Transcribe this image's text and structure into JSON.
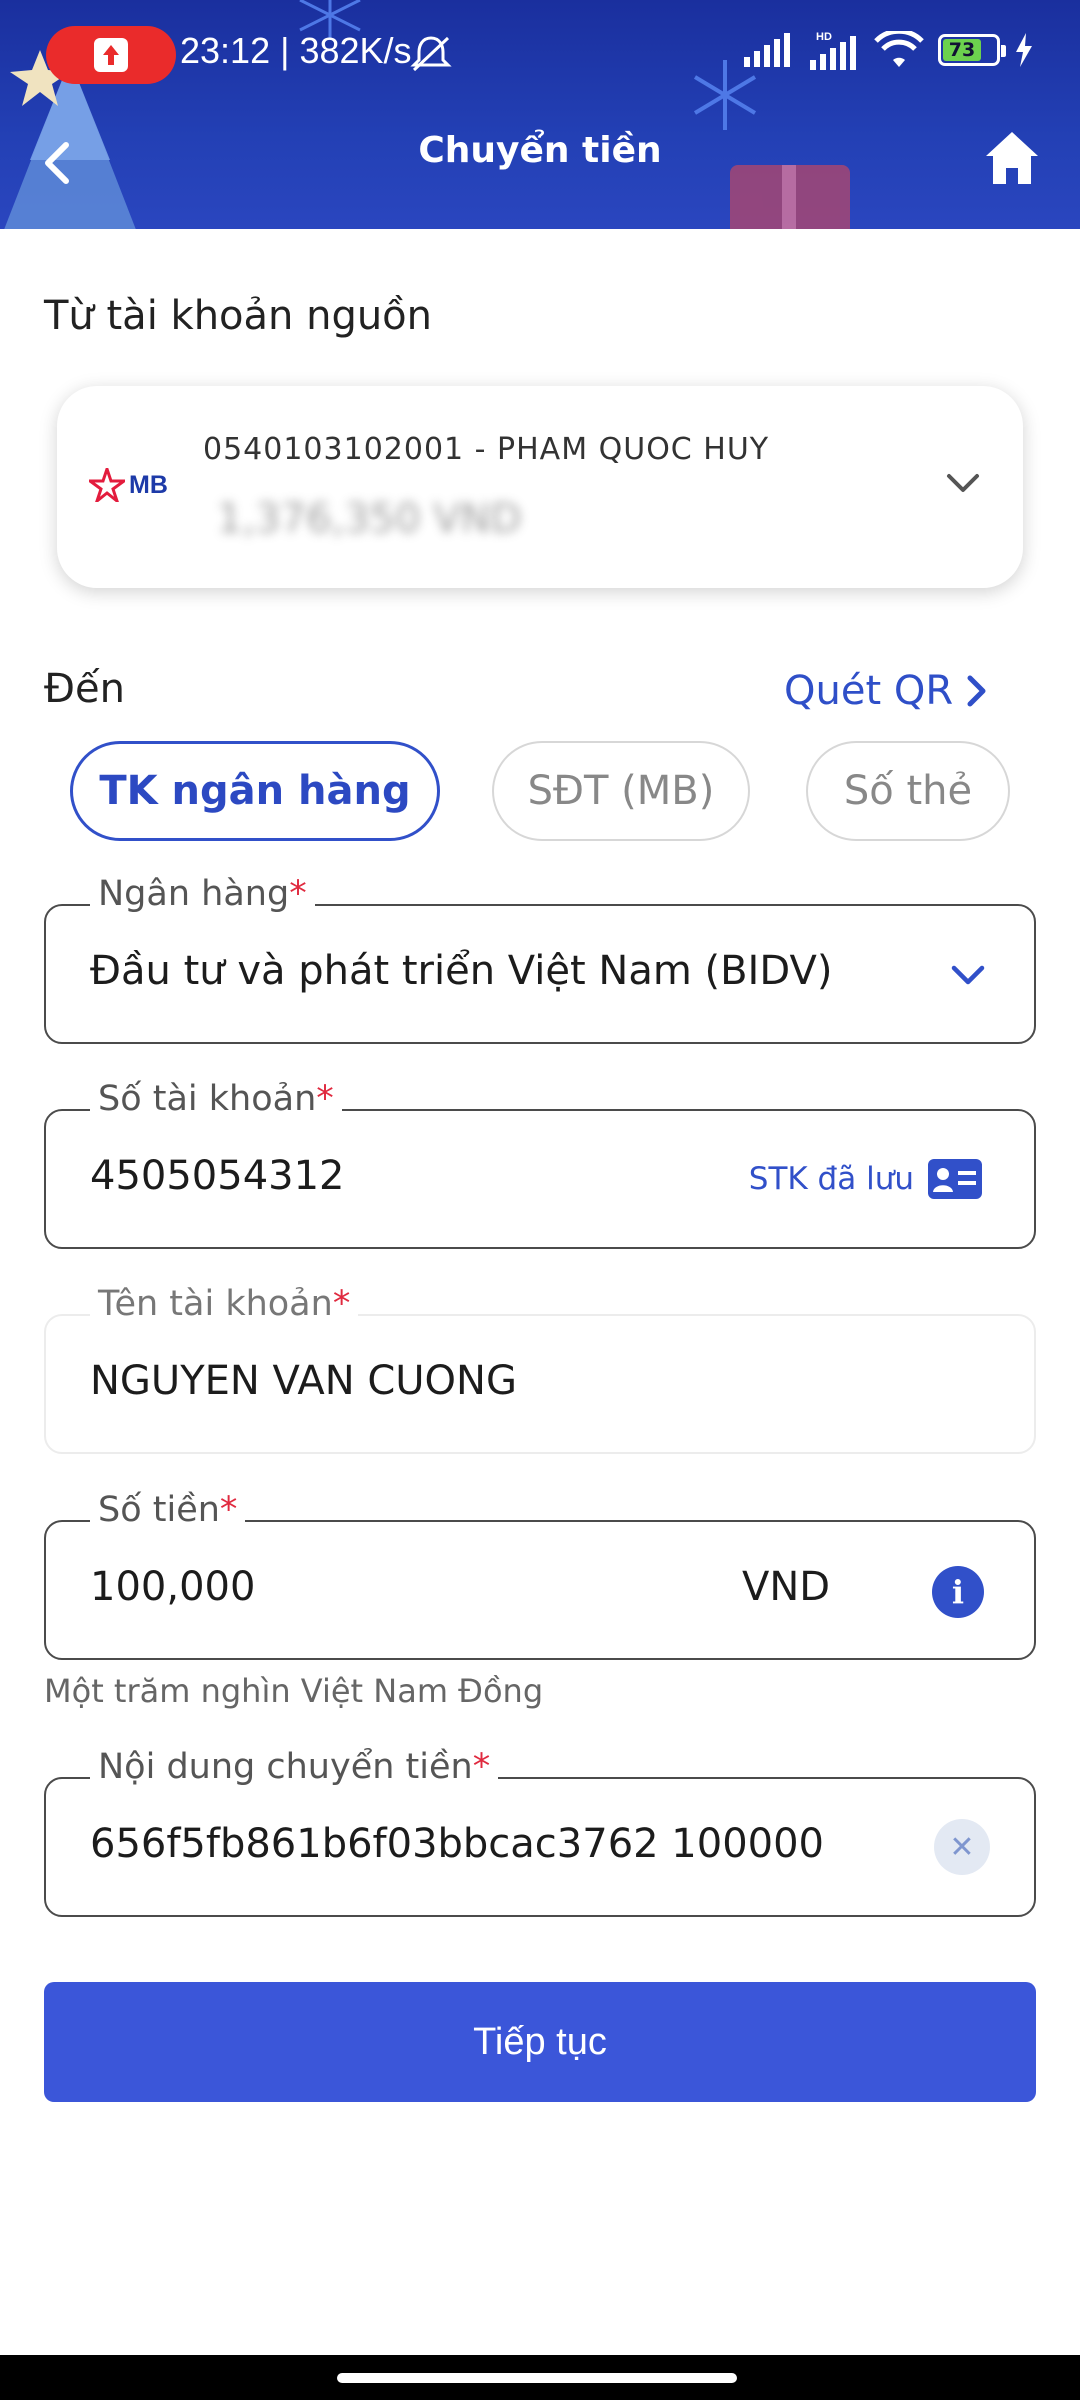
{
  "status_bar": {
    "time_speed": "23:12 | 382K/s",
    "battery": "73",
    "icons": [
      "record-icon",
      "mute-icon",
      "signal-icon",
      "hd-signal-icon",
      "wifi-icon",
      "battery-icon",
      "charging-icon"
    ]
  },
  "header": {
    "title": "Chuyển tiền",
    "back_icon": "chevron-left-icon",
    "home_icon": "home-icon"
  },
  "source": {
    "label": "Từ tài khoản nguồn",
    "bank_logo": "MB",
    "account": "0540103102001 - PHAM QUOC HUY",
    "balance": "1,376,350 VND"
  },
  "destination": {
    "label": "Đến",
    "qr_label": "Quét QR",
    "tabs": [
      {
        "label": "TK ngân hàng",
        "active": true
      },
      {
        "label": "SĐT (MB)",
        "active": false
      },
      {
        "label": "Số thẻ",
        "active": false
      }
    ]
  },
  "form": {
    "bank": {
      "label": "Ngân hàng",
      "required": "*",
      "value": "Đầu tư và phát triển Việt Nam (BIDV)"
    },
    "account_number": {
      "label": "Số tài khoản",
      "required": "*",
      "value": "4505054312",
      "saved_label": "STK đã lưu"
    },
    "account_name": {
      "label": "Tên tài khoản",
      "required": "*",
      "value": "NGUYEN VAN CUONG"
    },
    "amount": {
      "label": "Số tiền",
      "required": "*",
      "value": "100,000",
      "unit": "VND",
      "helper": "Một trăm nghìn Việt Nam Đồng"
    },
    "content": {
      "label": "Nội dung chuyển tiền",
      "required": "*",
      "value": "656f5fb861b6f03bbcac3762 100000"
    }
  },
  "actions": {
    "continue_label": "Tiếp tục"
  },
  "colors": {
    "primary": "#3b56d9",
    "header_bg": "#2340b5",
    "required": "#e02a3f"
  }
}
